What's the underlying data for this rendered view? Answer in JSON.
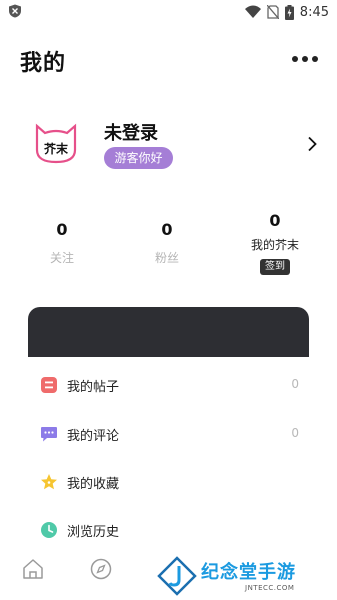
{
  "status_bar": {
    "time": "8:45"
  },
  "header": {
    "title": "我的"
  },
  "profile": {
    "name": "未登录",
    "badge": "游客你好",
    "avatar_text": "芥末"
  },
  "stats": [
    {
      "value": "0",
      "label": "关注"
    },
    {
      "value": "0",
      "label": "粉丝"
    },
    {
      "value": "0",
      "label": "我的芥末",
      "action": "签到"
    }
  ],
  "menu": [
    {
      "label": "我的帖子",
      "count": "0",
      "icon": "posts-icon"
    },
    {
      "label": "我的评论",
      "count": "0",
      "icon": "comment-icon"
    },
    {
      "label": "我的收藏",
      "count": "",
      "icon": "star-icon"
    },
    {
      "label": "浏览历史",
      "count": "",
      "icon": "history-icon"
    }
  ],
  "watermark": {
    "text": "纪念堂手游",
    "sub": "JNTECC.COM"
  },
  "colors": {
    "accent": "#a57ed6",
    "dark_card": "#2d2e33",
    "watermark": "#1b9ae0"
  }
}
